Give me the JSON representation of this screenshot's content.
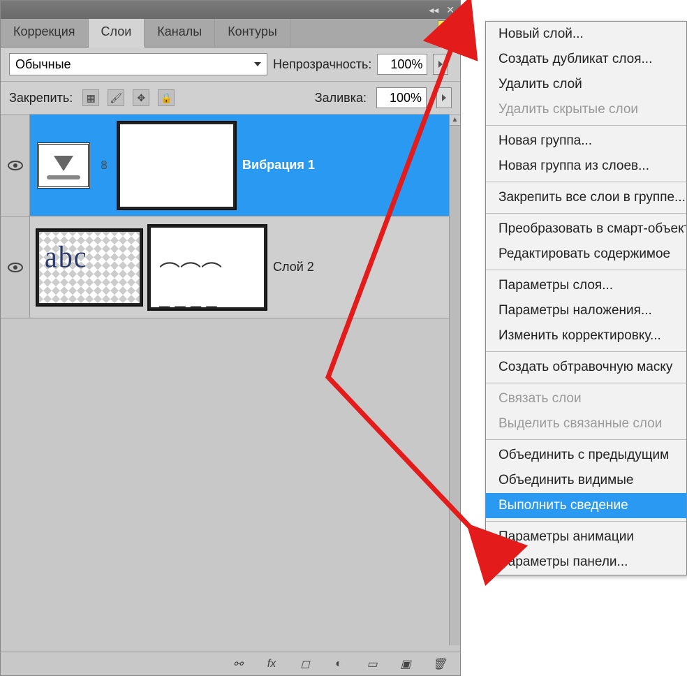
{
  "titlebar": {
    "collapse": "◂◂",
    "close": "✕"
  },
  "tabs": [
    {
      "label": "Коррекция",
      "active": false
    },
    {
      "label": "Слои",
      "active": true
    },
    {
      "label": "Каналы",
      "active": false
    },
    {
      "label": "Контуры",
      "active": false
    }
  ],
  "blend_mode": "Обычные",
  "opacity": {
    "label": "Непрозрачность:",
    "value": "100%"
  },
  "lock_label": "Закрепить:",
  "fill": {
    "label": "Заливка:",
    "value": "100%"
  },
  "layers": [
    {
      "name": "Вибрация 1",
      "selected": true
    },
    {
      "name": "Слой 2",
      "selected": false
    }
  ],
  "menu_items": [
    {
      "label": "Новый слой...",
      "type": "item"
    },
    {
      "label": "Создать дубликат слоя...",
      "type": "item"
    },
    {
      "label": "Удалить слой",
      "type": "item"
    },
    {
      "label": "Удалить скрытые слои",
      "type": "disabled"
    },
    {
      "type": "sep"
    },
    {
      "label": "Новая группа...",
      "type": "item"
    },
    {
      "label": "Новая группа из слоев...",
      "type": "item"
    },
    {
      "type": "sep"
    },
    {
      "label": "Закрепить все слои в группе...",
      "type": "item"
    },
    {
      "type": "sep"
    },
    {
      "label": "Преобразовать в смарт-объект",
      "type": "item"
    },
    {
      "label": "Редактировать содержимое",
      "type": "item"
    },
    {
      "type": "sep"
    },
    {
      "label": "Параметры слоя...",
      "type": "item"
    },
    {
      "label": "Параметры наложения...",
      "type": "item"
    },
    {
      "label": "Изменить корректировку...",
      "type": "item"
    },
    {
      "type": "sep"
    },
    {
      "label": "Создать обтравочную маску",
      "type": "item"
    },
    {
      "type": "sep"
    },
    {
      "label": "Связать слои",
      "type": "disabled"
    },
    {
      "label": "Выделить связанные слои",
      "type": "disabled"
    },
    {
      "type": "sep"
    },
    {
      "label": "Объединить с предыдущим",
      "type": "item"
    },
    {
      "label": "Объединить видимые",
      "type": "item"
    },
    {
      "label": "Выполнить сведение",
      "type": "highlight"
    },
    {
      "type": "sep"
    },
    {
      "label": "Параметры анимации",
      "type": "item"
    },
    {
      "label": "Параметры панели...",
      "type": "item"
    }
  ],
  "bottom_icons": [
    "link",
    "fx",
    "mask",
    "adjust",
    "folder",
    "new",
    "trash"
  ]
}
